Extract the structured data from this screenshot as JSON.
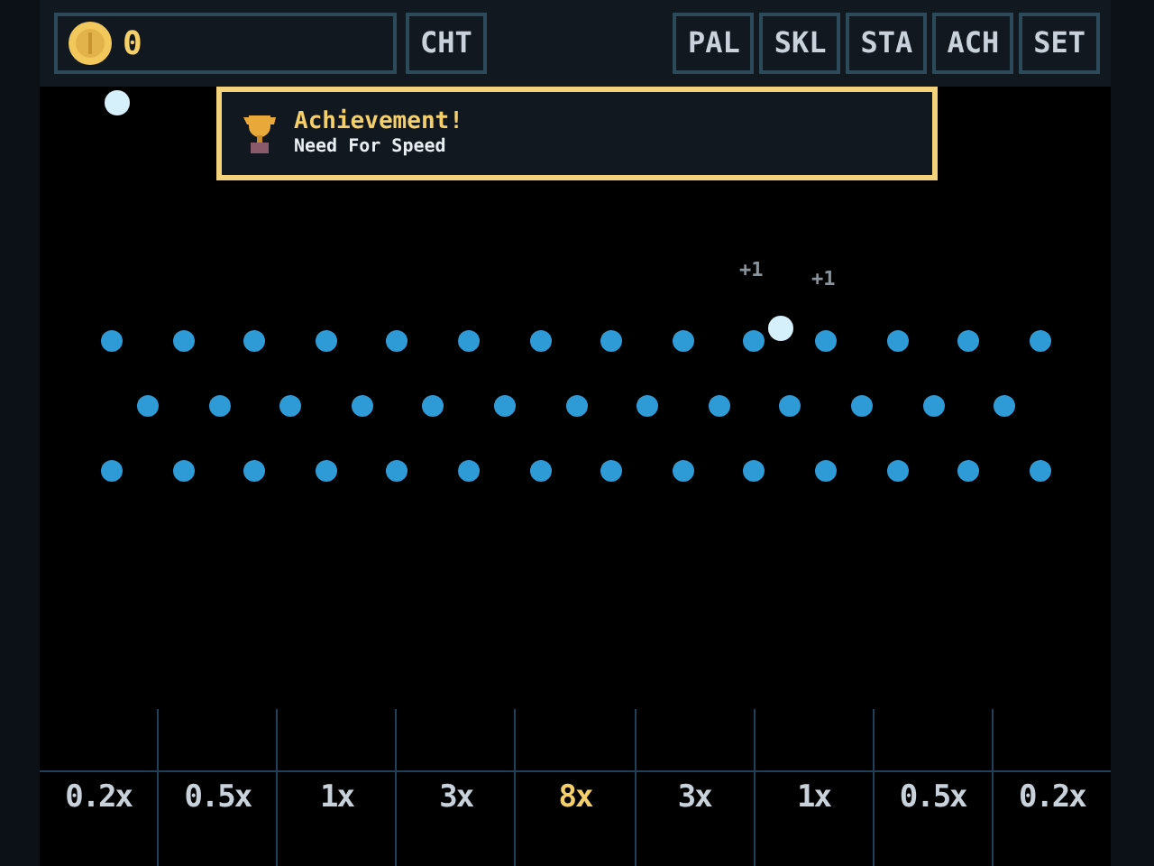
{
  "top_bar": {
    "coins": "0",
    "left_buttons": [
      "CHT"
    ],
    "right_buttons": [
      "PAL",
      "SKL",
      "STA",
      "ACH",
      "SET"
    ]
  },
  "toast": {
    "title": "Achievement!",
    "subtitle": "Need For Speed"
  },
  "score_popups": [
    "+1",
    "+1"
  ],
  "slots": [
    {
      "label": "0.2x",
      "highlighted": false
    },
    {
      "label": "0.5x",
      "highlighted": false
    },
    {
      "label": "1x",
      "highlighted": false
    },
    {
      "label": "3x",
      "highlighted": false
    },
    {
      "label": "8x",
      "highlighted": true
    },
    {
      "label": "3x",
      "highlighted": false
    },
    {
      "label": "1x",
      "highlighted": false
    },
    {
      "label": "0.5x",
      "highlighted": false
    },
    {
      "label": "0.2x",
      "highlighted": false
    }
  ]
}
